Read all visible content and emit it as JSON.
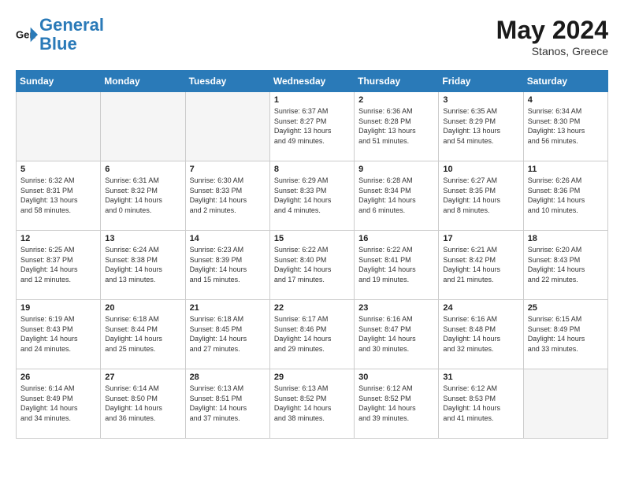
{
  "header": {
    "logo_line1": "General",
    "logo_line2": "Blue",
    "month": "May 2024",
    "location": "Stanos, Greece"
  },
  "weekdays": [
    "Sunday",
    "Monday",
    "Tuesday",
    "Wednesday",
    "Thursday",
    "Friday",
    "Saturday"
  ],
  "weeks": [
    [
      {
        "day": "",
        "content": ""
      },
      {
        "day": "",
        "content": ""
      },
      {
        "day": "",
        "content": ""
      },
      {
        "day": "1",
        "content": "Sunrise: 6:37 AM\nSunset: 8:27 PM\nDaylight: 13 hours\nand 49 minutes."
      },
      {
        "day": "2",
        "content": "Sunrise: 6:36 AM\nSunset: 8:28 PM\nDaylight: 13 hours\nand 51 minutes."
      },
      {
        "day": "3",
        "content": "Sunrise: 6:35 AM\nSunset: 8:29 PM\nDaylight: 13 hours\nand 54 minutes."
      },
      {
        "day": "4",
        "content": "Sunrise: 6:34 AM\nSunset: 8:30 PM\nDaylight: 13 hours\nand 56 minutes."
      }
    ],
    [
      {
        "day": "5",
        "content": "Sunrise: 6:32 AM\nSunset: 8:31 PM\nDaylight: 13 hours\nand 58 minutes."
      },
      {
        "day": "6",
        "content": "Sunrise: 6:31 AM\nSunset: 8:32 PM\nDaylight: 14 hours\nand 0 minutes."
      },
      {
        "day": "7",
        "content": "Sunrise: 6:30 AM\nSunset: 8:33 PM\nDaylight: 14 hours\nand 2 minutes."
      },
      {
        "day": "8",
        "content": "Sunrise: 6:29 AM\nSunset: 8:33 PM\nDaylight: 14 hours\nand 4 minutes."
      },
      {
        "day": "9",
        "content": "Sunrise: 6:28 AM\nSunset: 8:34 PM\nDaylight: 14 hours\nand 6 minutes."
      },
      {
        "day": "10",
        "content": "Sunrise: 6:27 AM\nSunset: 8:35 PM\nDaylight: 14 hours\nand 8 minutes."
      },
      {
        "day": "11",
        "content": "Sunrise: 6:26 AM\nSunset: 8:36 PM\nDaylight: 14 hours\nand 10 minutes."
      }
    ],
    [
      {
        "day": "12",
        "content": "Sunrise: 6:25 AM\nSunset: 8:37 PM\nDaylight: 14 hours\nand 12 minutes."
      },
      {
        "day": "13",
        "content": "Sunrise: 6:24 AM\nSunset: 8:38 PM\nDaylight: 14 hours\nand 13 minutes."
      },
      {
        "day": "14",
        "content": "Sunrise: 6:23 AM\nSunset: 8:39 PM\nDaylight: 14 hours\nand 15 minutes."
      },
      {
        "day": "15",
        "content": "Sunrise: 6:22 AM\nSunset: 8:40 PM\nDaylight: 14 hours\nand 17 minutes."
      },
      {
        "day": "16",
        "content": "Sunrise: 6:22 AM\nSunset: 8:41 PM\nDaylight: 14 hours\nand 19 minutes."
      },
      {
        "day": "17",
        "content": "Sunrise: 6:21 AM\nSunset: 8:42 PM\nDaylight: 14 hours\nand 21 minutes."
      },
      {
        "day": "18",
        "content": "Sunrise: 6:20 AM\nSunset: 8:43 PM\nDaylight: 14 hours\nand 22 minutes."
      }
    ],
    [
      {
        "day": "19",
        "content": "Sunrise: 6:19 AM\nSunset: 8:43 PM\nDaylight: 14 hours\nand 24 minutes."
      },
      {
        "day": "20",
        "content": "Sunrise: 6:18 AM\nSunset: 8:44 PM\nDaylight: 14 hours\nand 25 minutes."
      },
      {
        "day": "21",
        "content": "Sunrise: 6:18 AM\nSunset: 8:45 PM\nDaylight: 14 hours\nand 27 minutes."
      },
      {
        "day": "22",
        "content": "Sunrise: 6:17 AM\nSunset: 8:46 PM\nDaylight: 14 hours\nand 29 minutes."
      },
      {
        "day": "23",
        "content": "Sunrise: 6:16 AM\nSunset: 8:47 PM\nDaylight: 14 hours\nand 30 minutes."
      },
      {
        "day": "24",
        "content": "Sunrise: 6:16 AM\nSunset: 8:48 PM\nDaylight: 14 hours\nand 32 minutes."
      },
      {
        "day": "25",
        "content": "Sunrise: 6:15 AM\nSunset: 8:49 PM\nDaylight: 14 hours\nand 33 minutes."
      }
    ],
    [
      {
        "day": "26",
        "content": "Sunrise: 6:14 AM\nSunset: 8:49 PM\nDaylight: 14 hours\nand 34 minutes."
      },
      {
        "day": "27",
        "content": "Sunrise: 6:14 AM\nSunset: 8:50 PM\nDaylight: 14 hours\nand 36 minutes."
      },
      {
        "day": "28",
        "content": "Sunrise: 6:13 AM\nSunset: 8:51 PM\nDaylight: 14 hours\nand 37 minutes."
      },
      {
        "day": "29",
        "content": "Sunrise: 6:13 AM\nSunset: 8:52 PM\nDaylight: 14 hours\nand 38 minutes."
      },
      {
        "day": "30",
        "content": "Sunrise: 6:12 AM\nSunset: 8:52 PM\nDaylight: 14 hours\nand 39 minutes."
      },
      {
        "day": "31",
        "content": "Sunrise: 6:12 AM\nSunset: 8:53 PM\nDaylight: 14 hours\nand 41 minutes."
      },
      {
        "day": "",
        "content": ""
      }
    ]
  ]
}
